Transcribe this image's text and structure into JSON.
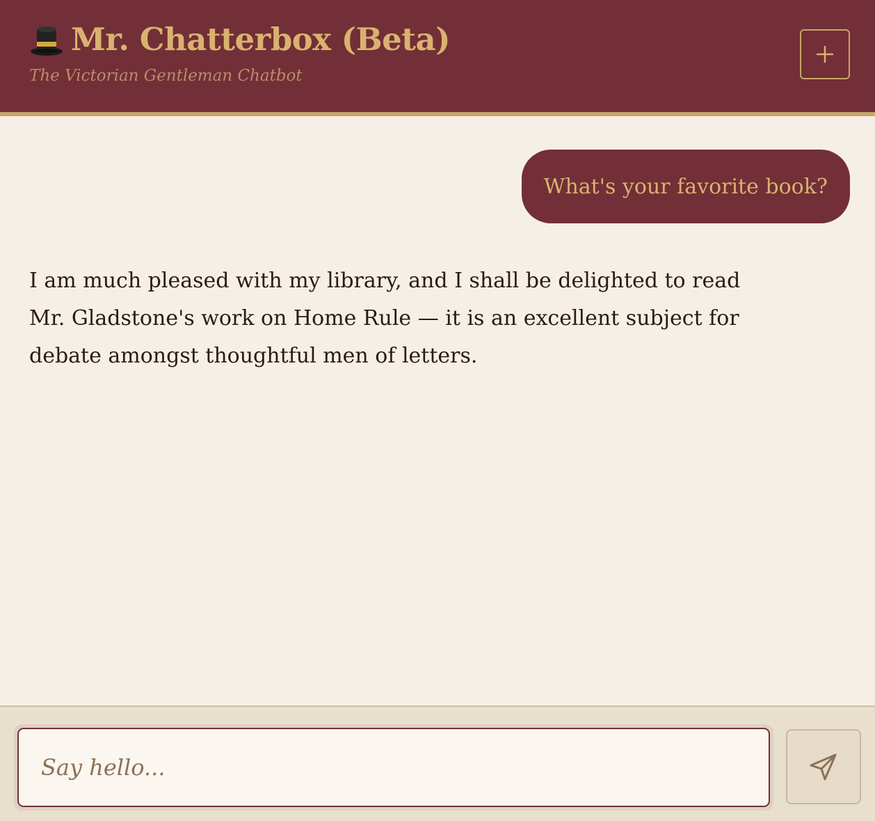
{
  "header": {
    "title": "Mr. Chatterbox (Beta)",
    "subtitle": "The Victorian Gentleman Chatbot",
    "title_icon": "top-hat-icon",
    "new_chat_icon": "plus-icon"
  },
  "conversation": {
    "messages": [
      {
        "role": "user",
        "text": "What's your favorite book?"
      },
      {
        "role": "bot",
        "text": "I am much pleased with my library, and I shall be delighted to read Mr. Gladstone's work on Home Rule — it is an excellent subject for debate amongst thoughtful men of letters."
      }
    ]
  },
  "composer": {
    "placeholder": "Say hello...",
    "value": "",
    "send_icon": "send-icon"
  },
  "colors": {
    "header_bg": "#722f37",
    "accent_gold": "#d9b26f",
    "page_bg": "#f6efe7",
    "input_bar_bg": "#e8dfcd"
  }
}
